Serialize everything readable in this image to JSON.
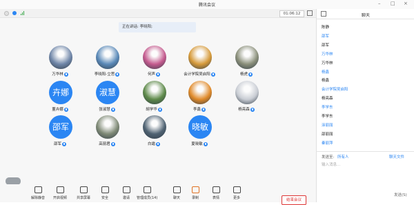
{
  "window": {
    "title": "腾讯会议",
    "controls": [
      "–",
      "□",
      "×"
    ]
  },
  "infobar": {
    "timer": "01:06:12"
  },
  "toast": {
    "text": "正在讲话: 李晓阳;"
  },
  "participants": [
    {
      "name": "万华林",
      "avatar_type": "photo",
      "photo_color": "#6f86a8"
    },
    {
      "name": "李晓阳-立思",
      "avatar_type": "photo",
      "photo_color": "#5a89b8"
    },
    {
      "name": "何声",
      "avatar_type": "photo",
      "photo_color": "#c45a8e"
    },
    {
      "name": "会计学院吴启阳",
      "avatar_type": "photo",
      "photo_color": "#d69a3a"
    },
    {
      "name": "杨虎",
      "avatar_type": "photo",
      "photo_color": "#8a8f7a"
    },
    {
      "name": "董卉娜",
      "avatar_type": "text",
      "avatar_text": "卉娜"
    },
    {
      "name": "张淑慧",
      "avatar_type": "text",
      "avatar_text": "淑慧"
    },
    {
      "name": "胡学华",
      "avatar_type": "photo",
      "photo_color": "#5e8a4a"
    },
    {
      "name": "李鑫",
      "avatar_type": "photo",
      "photo_color": "#e08a2a"
    },
    {
      "name": "杨亮森",
      "avatar_type": "photo",
      "photo_color": "#c9cdd4"
    },
    {
      "name": "邵军",
      "avatar_type": "text",
      "avatar_text": "邵军"
    },
    {
      "name": "高丽君",
      "avatar_type": "photo",
      "photo_color": "#7f8a76"
    },
    {
      "name": "白霜",
      "avatar_type": "photo",
      "photo_color": "#4f6272"
    },
    {
      "name": "夏晓敏",
      "avatar_type": "text",
      "avatar_text": "晓敏"
    }
  ],
  "toolbar": {
    "items": [
      {
        "label": "解除静音",
        "icon": "mic-muted-icon"
      },
      {
        "label": "开启视频",
        "icon": "video-off-icon"
      },
      {
        "label": "共享屏幕",
        "icon": "share-screen-icon"
      },
      {
        "label": "安全",
        "icon": "shield-icon"
      },
      {
        "label": "邀请",
        "icon": "invite-icon"
      },
      {
        "label": "管理成员(14)",
        "icon": "members-icon"
      },
      {
        "label": "聊天",
        "icon": "chat-icon"
      },
      {
        "label": "录制",
        "icon": "record-icon"
      },
      {
        "label": "表情",
        "icon": "emoji-icon"
      },
      {
        "label": "更多",
        "icon": "more-icon"
      }
    ],
    "leave_label": "结束会议"
  },
  "chat": {
    "title": "聊天",
    "messages": [
      {
        "text": "陈静",
        "style": "dark"
      },
      {
        "text": "邵军",
        "style": "blue"
      },
      {
        "text": "邵军",
        "style": "dark"
      },
      {
        "text": "万华林",
        "style": "blue"
      },
      {
        "text": "万华林",
        "style": "dark"
      },
      {
        "text": "杨鑫",
        "style": "blue"
      },
      {
        "text": "杨鑫",
        "style": "dark"
      },
      {
        "text": "会计学院吴启阳",
        "style": "blue"
      },
      {
        "text": "杨亮森",
        "style": "dark"
      },
      {
        "text": "李学东",
        "style": "blue"
      },
      {
        "text": "李学东",
        "style": "dark"
      },
      {
        "text": "涂丽丽",
        "style": "blue"
      },
      {
        "text": "邵丽丽",
        "style": "dark"
      },
      {
        "text": "秦丽萍",
        "style": "blue"
      }
    ],
    "send_to_label": "发送至:",
    "send_to_value": "所有人",
    "file_label": "聊天文件",
    "input_placeholder": "输入消息...",
    "send_button": "发送(S)"
  },
  "colors": {
    "accent": "#2b86f3",
    "leave": "#d33333"
  }
}
